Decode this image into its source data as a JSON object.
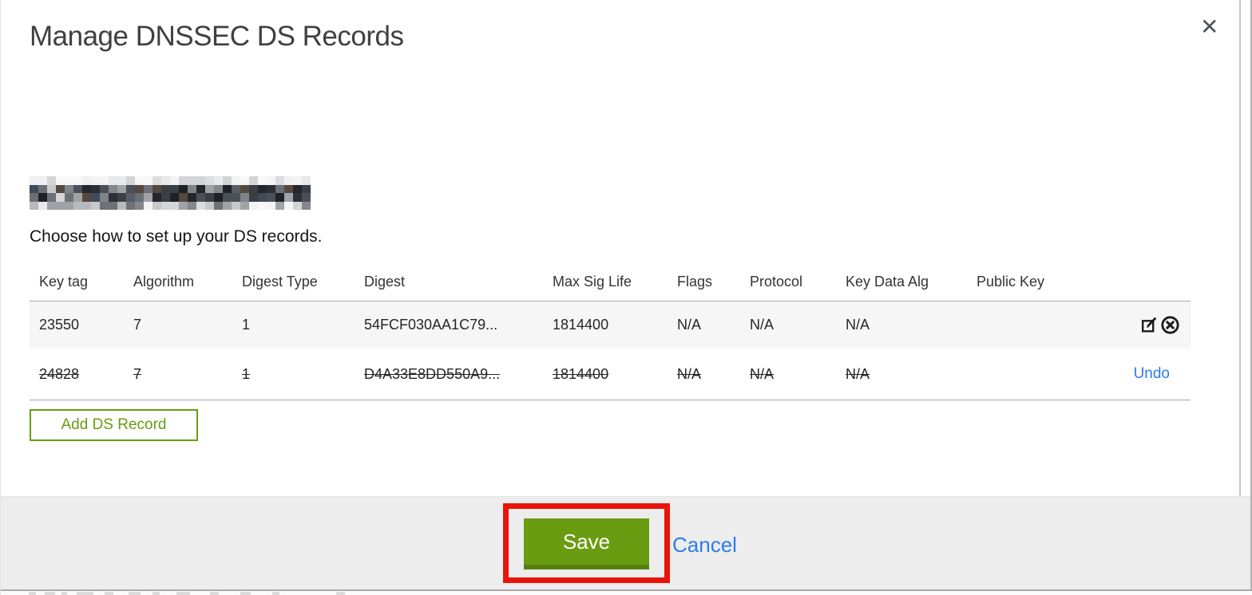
{
  "modal": {
    "title": "Manage DNSSEC DS Records",
    "close_icon": "✕",
    "instruction": "Choose how to set up your DS records.",
    "add_button_label": "Add DS Record",
    "save_button_label": "Save",
    "cancel_label": "Cancel",
    "undo_label": "Undo",
    "domain_redacted": true
  },
  "table": {
    "headers": [
      "Key tag",
      "Algorithm",
      "Digest Type",
      "Digest",
      "Max Sig Life",
      "Flags",
      "Protocol",
      "Key Data Alg",
      "Public Key"
    ],
    "rows": [
      {
        "cells": [
          "23550",
          "7",
          "1",
          "54FCF030AA1C79...",
          "1814400",
          "N/A",
          "N/A",
          "N/A",
          ""
        ],
        "state": "normal",
        "actions": [
          "edit",
          "delete"
        ]
      },
      {
        "cells": [
          "24828",
          "7",
          "1",
          "D4A33E8DD550A9...",
          "1814400",
          "N/A",
          "N/A",
          "N/A",
          ""
        ],
        "state": "deleted",
        "actions": [
          "undo"
        ]
      }
    ]
  },
  "colors": {
    "accent_green": "#699c10",
    "green_dark": "#56800c",
    "link_blue": "#2e7bea",
    "red_annotation": "#ea1309",
    "footer_bg": "#ededed",
    "row_alt_bg": "#f6f6f6",
    "border_gray": "#a8a8a8",
    "text_dark": "#262626",
    "title_color": "#3f4042"
  },
  "redaction": {
    "palette_light": [
      "#f4f4f4",
      "#e8e9ea",
      "#dcdde0",
      "#eef0f1",
      "#f8f8f8",
      "#d2d4d6"
    ],
    "palette_dark": [
      "#3a3e45",
      "#2c3036",
      "#4b5058",
      "#585d66",
      "#23262b",
      "#6b7076",
      "#55493f",
      "#3f4a5a",
      "#808489",
      "#1e2126"
    ],
    "palette_mid": [
      "#9fa3a8",
      "#b7babc",
      "#84888d",
      "#c7c9cb",
      "#6e7277",
      "#d4d5d7"
    ]
  }
}
